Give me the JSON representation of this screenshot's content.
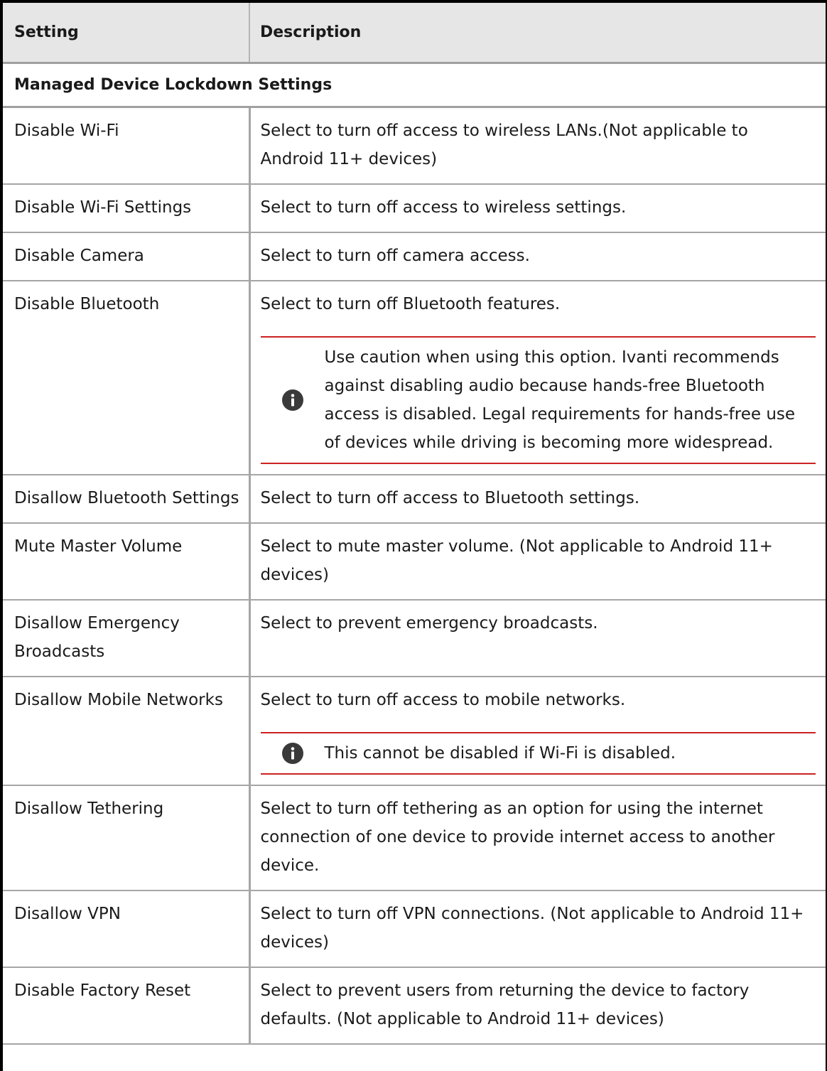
{
  "table": {
    "headers": {
      "setting": "Setting",
      "description": "Description"
    },
    "section_title": "Managed Device Lockdown Settings",
    "rows": [
      {
        "setting": "Disable Wi-Fi",
        "description": "Select to turn off access to wireless LANs.(Not applicable to Android 11+ devices)"
      },
      {
        "setting": "Disable Wi-Fi Settings",
        "description": "Select to turn off access to wireless settings."
      },
      {
        "setting": "Disable Camera",
        "description": "Select to turn off camera access."
      },
      {
        "setting": "Disable Bluetooth",
        "description": "Select to turn off Bluetooth features.",
        "note": "Use caution when using this option. Ivanti recommends against disabling audio because hands-free Bluetooth access is disabled. Legal requirements for hands-free use of devices while driving is becoming more widespread."
      },
      {
        "setting": "Disallow Bluetooth Settings",
        "description": "Select to turn off access to Bluetooth settings."
      },
      {
        "setting": "Mute Master Volume",
        "description": "Select to mute master volume. (Not applicable to Android 11+ devices)"
      },
      {
        "setting": "Disallow Emergency Broadcasts",
        "description": "Select to prevent emergency broadcasts."
      },
      {
        "setting": "Disallow Mobile Networks",
        "description": "Select to turn off access to mobile networks.",
        "note": "This cannot be disabled if Wi-Fi is disabled."
      },
      {
        "setting": "Disallow Tethering",
        "description": "Select to turn off tethering as an option for using the internet connection of one device to provide internet access to another device."
      },
      {
        "setting": "Disallow VPN",
        "description": "Select to turn off VPN connections. (Not applicable to Android 11+ devices)"
      },
      {
        "setting": "Disable Factory Reset",
        "description": "Select to prevent users from returning the device to factory defaults. (Not applicable to Android 11+ devices)"
      }
    ]
  },
  "note_icon": "info-icon",
  "colors": {
    "header_background": "#e6e6e6",
    "note_rule": "#cc2222",
    "note_icon": "#3a3a3a"
  }
}
